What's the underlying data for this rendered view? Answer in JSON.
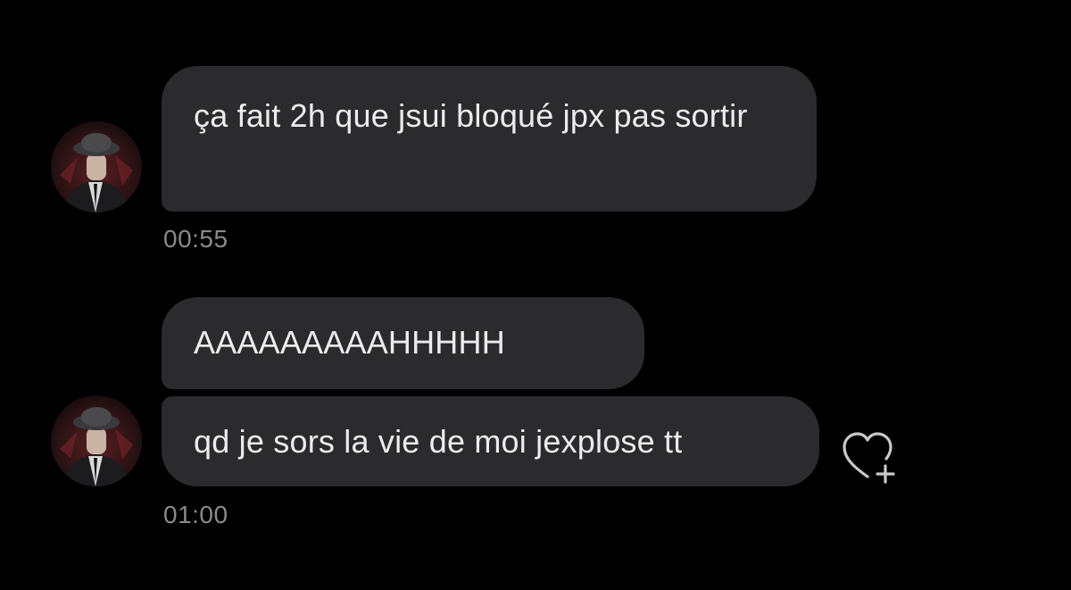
{
  "conversation": {
    "groups": [
      {
        "messages": [
          {
            "text": "ça fait 2h que jsui bloqué jpx pas sortir"
          }
        ],
        "time": "00:55",
        "avatar_icon": "user-avatar-icon"
      },
      {
        "messages": [
          {
            "text": "AAAAAAAAAHHHHH"
          },
          {
            "text": "qd je sors la vie de moi jexplose tt"
          }
        ],
        "time": "01:00",
        "avatar_icon": "user-avatar-icon"
      }
    ]
  },
  "actions": {
    "react_icon": "heart-add-icon"
  },
  "colors": {
    "background": "#000000",
    "bubble": "#2b2b2e",
    "text": "#ececee",
    "timestamp": "#8a8a8e"
  }
}
